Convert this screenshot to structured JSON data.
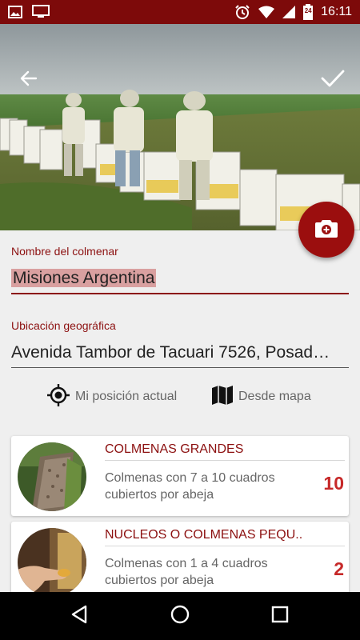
{
  "status_bar": {
    "time": "16:11",
    "calendar_day": "24",
    "icons": [
      "image-icon",
      "screen-icon",
      "alarm-icon",
      "wifi-icon",
      "signal-icon",
      "battery-icon"
    ]
  },
  "header": {
    "back_icon": "arrow-left-icon",
    "confirm_icon": "check-icon",
    "camera_icon": "camera-add-icon"
  },
  "form": {
    "name_label": "Nombre del colmenar",
    "name_value": "Misiones Argentina",
    "location_label": "Ubicación geográfica",
    "location_value": "Avenida Tambor de Tacuari 7526, Posad…",
    "current_position_label": "Mi posición actual",
    "from_map_label": "Desde mapa"
  },
  "hives": [
    {
      "title": "COLMENAS GRANDES",
      "description": "Colmenas con 7 a 10 cuadros cubiertos por abeja",
      "count": "10"
    },
    {
      "title": "NUCLEOS O COLMENAS PEQU..",
      "description": "Colmenas con 1 a 4 cuadros cubiertos por abeja",
      "count": "2"
    }
  ],
  "colors": {
    "primary": "#7d0a0a",
    "accent": "#9b0e0e",
    "count": "#c62828"
  }
}
